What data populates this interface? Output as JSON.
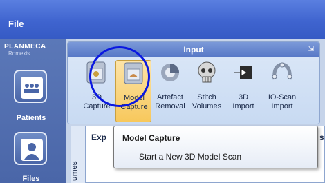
{
  "menu": {
    "file_label": "File"
  },
  "brand": {
    "name": "PLANMECA",
    "product": "Romexis"
  },
  "sidebar": {
    "items": [
      {
        "label": "Patients",
        "icon": "people-icon"
      },
      {
        "label": "Files",
        "icon": "person-icon"
      }
    ]
  },
  "ribbon": {
    "group_title": "Input",
    "launcher_icon": "dialog-launcher-icon",
    "tools": [
      {
        "label": "3D\nCapture",
        "icon": "3d-capture-icon"
      },
      {
        "label": "Model\nCapture",
        "icon": "model-capture-icon",
        "selected": true
      },
      {
        "label": "Artefact\nRemoval",
        "icon": "artefact-removal-icon"
      },
      {
        "label": "Stitch\nVolumes",
        "icon": "skull-icon"
      },
      {
        "label": "3D\nImport",
        "icon": "import-icon"
      },
      {
        "label": "IO-Scan\nImport",
        "icon": "io-scan-icon"
      }
    ]
  },
  "panel": {
    "vertical_tab": "umes",
    "header_fragment": "Exp",
    "edge_fragment": "s"
  },
  "tooltip": {
    "title": "Model Capture",
    "description": "Start a New 3D Model Scan"
  },
  "colors": {
    "titlebar": "#3f64cf",
    "sidebar": "#4a66a8",
    "ribbon_header": "#5677c6",
    "annotation_circle": "#0a18e0",
    "selected_tool": "#f7c85c"
  }
}
